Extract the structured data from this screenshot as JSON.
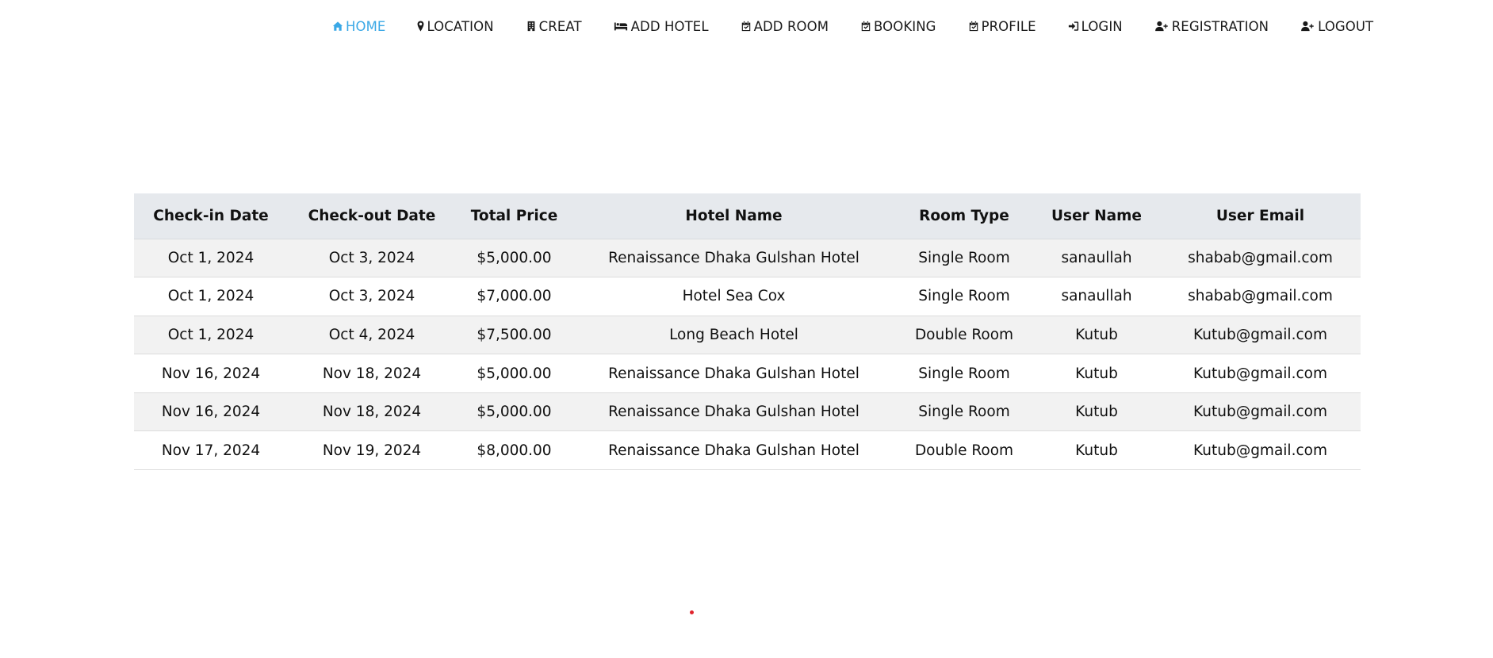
{
  "nav": {
    "items": [
      {
        "label": "HOME",
        "icon": "home-icon",
        "active": true
      },
      {
        "label": "LOCATION",
        "icon": "map-marker-icon",
        "active": false
      },
      {
        "label": "CREAT",
        "icon": "building-icon",
        "active": false
      },
      {
        "label": "ADD HOTEL",
        "icon": "bed-icon",
        "active": false
      },
      {
        "label": "ADD ROOM",
        "icon": "calendar-check-icon",
        "active": false
      },
      {
        "label": "BOOKING",
        "icon": "calendar-check-icon",
        "active": false
      },
      {
        "label": "PROFILE",
        "icon": "calendar-check-icon",
        "active": false
      },
      {
        "label": "LOGIN",
        "icon": "sign-in-icon",
        "active": false
      },
      {
        "label": "REGISTRATION",
        "icon": "user-plus-icon",
        "active": false
      },
      {
        "label": "LOGOUT",
        "icon": "user-plus-icon",
        "active": false
      }
    ],
    "active_color": "#3aa8e6"
  },
  "bookings": {
    "headers": [
      "Check-in Date",
      "Check-out Date",
      "Total Price",
      "Hotel Name",
      "Room Type",
      "User Name",
      "User Email"
    ],
    "rows": [
      [
        "Oct 1, 2024",
        "Oct 3, 2024",
        "$5,000.00",
        "Renaissance Dhaka Gulshan Hotel",
        "Single Room",
        "sanaullah",
        "shabab@gmail.com"
      ],
      [
        "Oct 1, 2024",
        "Oct 3, 2024",
        "$7,000.00",
        "Hotel Sea Cox",
        "Single Room",
        "sanaullah",
        "shabab@gmail.com"
      ],
      [
        "Oct 1, 2024",
        "Oct 4, 2024",
        "$7,500.00",
        "Long Beach Hotel",
        "Double Room",
        "Kutub",
        "Kutub@gmail.com"
      ],
      [
        "Nov 16, 2024",
        "Nov 18, 2024",
        "$5,000.00",
        "Renaissance Dhaka Gulshan Hotel",
        "Single Room",
        "Kutub",
        "Kutub@gmail.com"
      ],
      [
        "Nov 16, 2024",
        "Nov 18, 2024",
        "$5,000.00",
        "Renaissance Dhaka Gulshan Hotel",
        "Single Room",
        "Kutub",
        "Kutub@gmail.com"
      ],
      [
        "Nov 17, 2024",
        "Nov 19, 2024",
        "$8,000.00",
        "Renaissance Dhaka Gulshan Hotel",
        "Double Room",
        "Kutub",
        "Kutub@gmail.com"
      ]
    ]
  },
  "colors": {
    "header_bg": "#e6e9ed",
    "stripe_bg": "#f2f2f2",
    "dot": "#e0232c"
  }
}
